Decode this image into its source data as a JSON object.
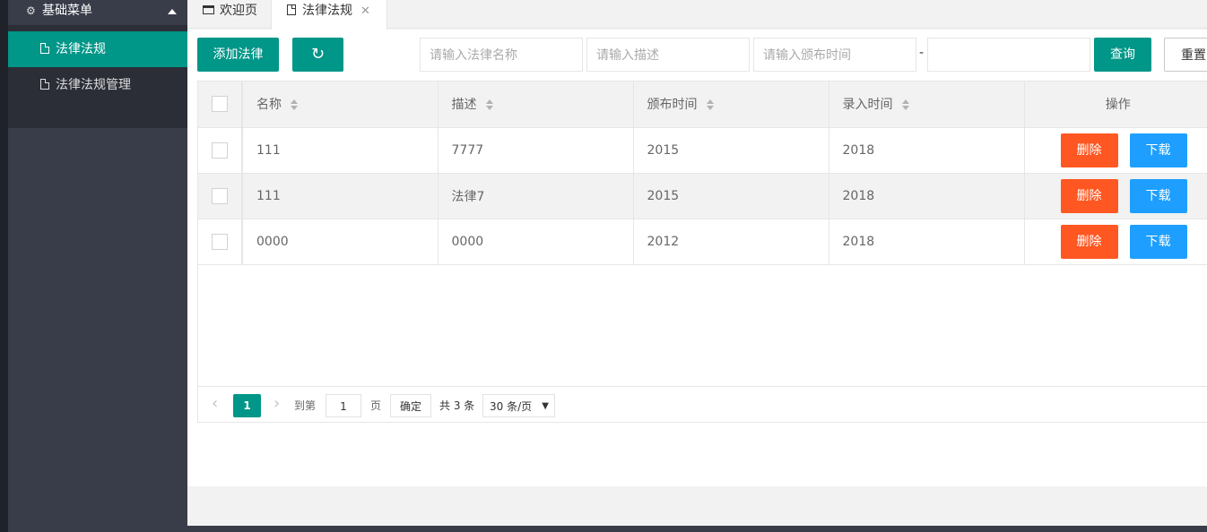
{
  "sidebar": {
    "group_label": "基础菜单",
    "items": [
      {
        "label": "法律法规",
        "active": true
      },
      {
        "label": "法律法规管理",
        "active": false
      }
    ]
  },
  "tabs": [
    {
      "label": "欢迎页",
      "icon": "window-icon"
    },
    {
      "label": "法律法规",
      "icon": "file-icon",
      "closable": true
    }
  ],
  "toolbar": {
    "add_label": "添加法律",
    "refresh_icon": "refresh-icon",
    "name_placeholder": "请输入法律名称",
    "desc_placeholder": "请输入描述",
    "date_placeholder": "请输入颁布时间",
    "date_end_placeholder": "",
    "range_sep": "-",
    "search_label": "查询",
    "reset_label": "重置"
  },
  "table": {
    "columns": [
      "名称",
      "描述",
      "颁布时间",
      "录入时间",
      "操作"
    ],
    "rows": [
      {
        "name": "111",
        "desc": "7777",
        "issued": "2015",
        "entered": "2018"
      },
      {
        "name": "111",
        "desc": "法律7",
        "issued": "2015",
        "entered": "2018"
      },
      {
        "name": "0000",
        "desc": "0000",
        "issued": "2012",
        "entered": "2018"
      }
    ],
    "delete_label": "删除",
    "download_label": "下载"
  },
  "pagination": {
    "prev": "‹",
    "current": "1",
    "next": "›",
    "goto_label": "到第",
    "goto_value": "1",
    "page_unit": "页",
    "confirm_label": "确定",
    "total_label": "共 3 条",
    "page_size": "30 条/页"
  },
  "colors": {
    "accent": "#009688",
    "danger": "#ff5722",
    "info": "#1e9fff",
    "sidebar_bg": "#393d49"
  }
}
